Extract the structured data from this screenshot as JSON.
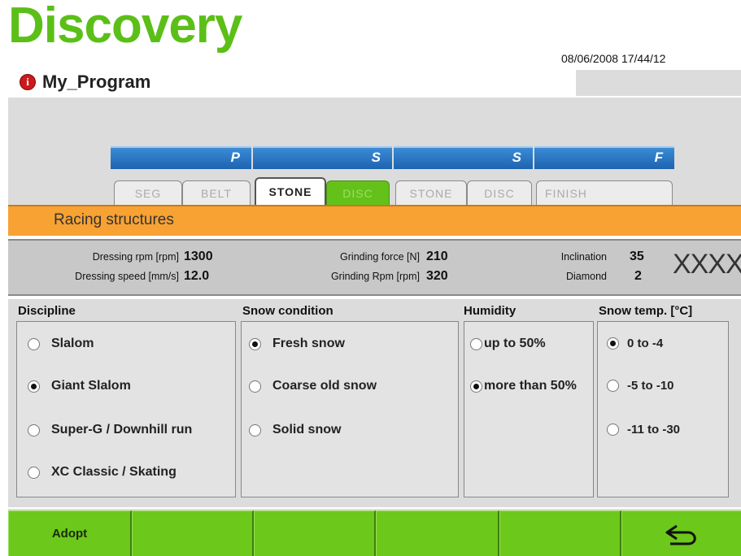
{
  "header": {
    "app_title": "Discovery",
    "program_name": "My_Program",
    "datetime": "08/06/2008 17/44/12",
    "icons": {
      "info": "info-icon",
      "back": "back-arrow-icon"
    }
  },
  "tab_groups": [
    {
      "letter": "P",
      "tabs": [
        "SEG",
        "BELT"
      ]
    },
    {
      "letter": "S",
      "tabs": [
        "STONE",
        "DISC"
      ]
    },
    {
      "letter": "S",
      "tabs": [
        "STONE",
        "DISC"
      ]
    },
    {
      "letter": "F",
      "tabs": [
        "FINISH"
      ]
    }
  ],
  "active_tab": "STONE",
  "section_title": "Racing structures",
  "params": {
    "dressing_rpm_label": "Dressing rpm [rpm]",
    "dressing_rpm_value": "1300",
    "dressing_speed_label": "Dressing speed [mm/s]",
    "dressing_speed_value": "12.0",
    "grinding_force_label": "Grinding force [N]",
    "grinding_force_value": "210",
    "grinding_rpm_label": "Grinding Rpm [rpm]",
    "grinding_rpm_value": "320",
    "inclination_label": "Inclination",
    "inclination_value": "35",
    "diamond_label": "Diamond",
    "diamond_value": "2",
    "code": "XXXX"
  },
  "discipline": {
    "header": "Discipline",
    "options": [
      "Slalom",
      "Giant Slalom",
      "Super-G / Downhill run",
      "XC Classic / Skating"
    ],
    "selected": "Giant Slalom"
  },
  "snow_condition": {
    "header": "Snow condition",
    "options": [
      "Fresh snow",
      "Coarse old snow",
      "Solid snow"
    ],
    "selected": "Fresh snow"
  },
  "humidity": {
    "header": "Humidity",
    "options": [
      "up to 50%",
      "more than 50%"
    ],
    "selected": "more than 50%"
  },
  "snow_temp": {
    "header": "Snow temp. [°C]",
    "options": [
      "0 to -4",
      "-5 to -10",
      "-11 to -30"
    ],
    "selected": "0 to -4"
  },
  "buttons": {
    "adopt": "Adopt"
  },
  "colors": {
    "brand_green": "#5bbf18",
    "orange": "#f7a233",
    "tab_blue": "#1d63b0",
    "button_green": "#6cc81a"
  }
}
